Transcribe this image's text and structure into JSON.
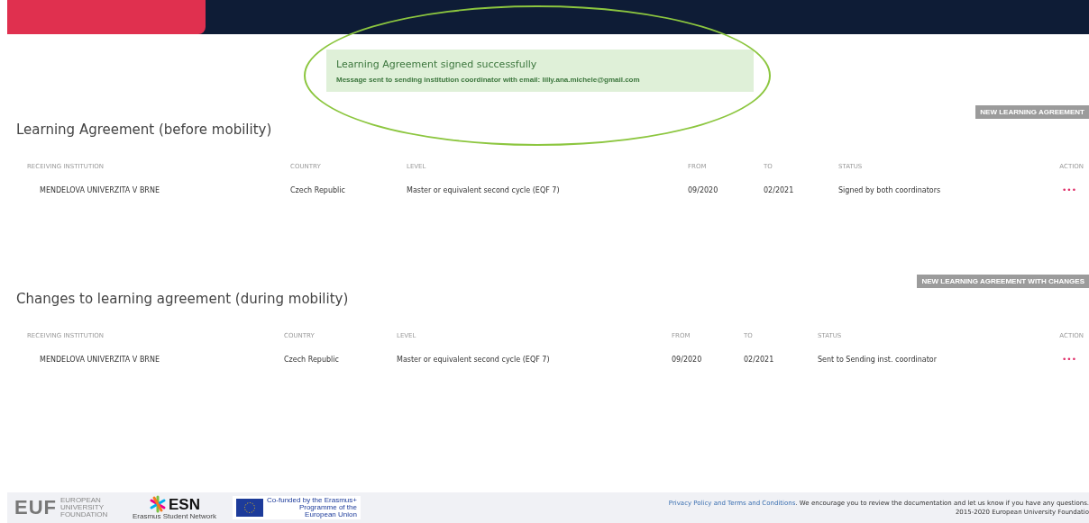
{
  "alert": {
    "title": "Learning Agreement signed successfully",
    "message": "Message sent to sending institution coordinator with email: lilly.ana.michele@gmail.com"
  },
  "sections": [
    {
      "title": "Learning Agreement (before mobility)",
      "button": "NEW LEARNING AGREEMENT",
      "columns": [
        "RECEIVING INSTITUTION",
        "COUNTRY",
        "LEVEL",
        "FROM",
        "TO",
        "STATUS",
        "ACTION"
      ],
      "rows": [
        {
          "cells": [
            "MENDELOVA UNIVERZITA V BRNE",
            "Czech Republic",
            "Master or equivalent second cycle (EQF 7)",
            "09/2020",
            "02/2021",
            "Signed by both coordinators"
          ],
          "action": "•••"
        }
      ]
    },
    {
      "title": "Changes to learning agreement (during mobility)",
      "button": "NEW LEARNING AGREEMENT WITH CHANGES",
      "columns": [
        "RECEIVING INSTITUTION",
        "COUNTRY",
        "LEVEL",
        "FROM",
        "TO",
        "STATUS",
        "ACTION"
      ],
      "rows": [
        {
          "cells": [
            "MENDELOVA UNIVERZITA V BRNE",
            "Czech Republic",
            "Master or equivalent second cycle (EQF 7)",
            "09/2020",
            "02/2021",
            "Sent to Sending inst. coordinator"
          ],
          "action": "•••"
        }
      ]
    }
  ],
  "footer": {
    "logos": [
      {
        "kind": "euf",
        "mark": "EUF",
        "text": "EUROPEAN UNIVERSITY FOUNDATION"
      },
      {
        "kind": "esn",
        "mark": "ESN",
        "text": "Erasmus Student Network"
      },
      {
        "kind": "eu",
        "text": "Co-funded by the Erasmus+ Programme of the European Union"
      }
    ],
    "link": "Privacy Policy and Terms and Conditions",
    "notice": ". We encourage you to review the documentation and let us know if you have any questions.",
    "copyright": "2015-2020 European University Foundatio"
  }
}
